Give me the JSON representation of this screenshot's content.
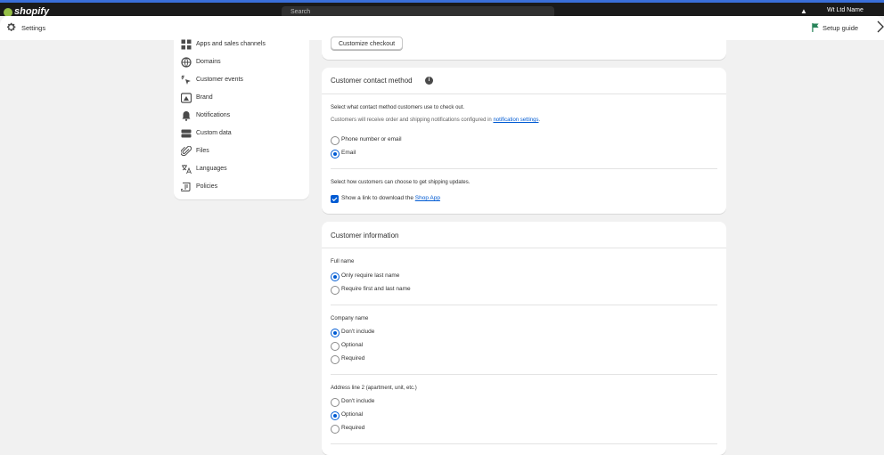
{
  "topbar": {
    "logo": "shopify",
    "search_placeholder": "Search",
    "store_name": "Wt Ltd Name"
  },
  "header": {
    "title": "Settings",
    "setup_guide": "Setup guide"
  },
  "sidebar": {
    "items": [
      {
        "label": "Apps and sales channels",
        "icon": "apps-icon"
      },
      {
        "label": "Domains",
        "icon": "globe-icon"
      },
      {
        "label": "Customer events",
        "icon": "cursor-sparkle-icon"
      },
      {
        "label": "Brand",
        "icon": "brand-icon"
      },
      {
        "label": "Notifications",
        "icon": "bell-icon"
      },
      {
        "label": "Custom data",
        "icon": "database-icon"
      },
      {
        "label": "Files",
        "icon": "paperclip-icon"
      },
      {
        "label": "Languages",
        "icon": "translate-icon"
      },
      {
        "label": "Policies",
        "icon": "policy-icon"
      }
    ]
  },
  "checkout_card": {
    "customize_button": "Customize checkout"
  },
  "contact_card": {
    "title": "Customer contact method",
    "select_text": "Select what contact method customers use to check out.",
    "notify_prefix": "Customers will receive order and shipping notifications configured in ",
    "notify_link": "notification settings",
    "notify_suffix": ".",
    "options": [
      {
        "label": "Phone number or email",
        "selected": false
      },
      {
        "label": "Email",
        "selected": true
      }
    ],
    "shipping_text": "Select how customers can choose to get shipping updates.",
    "shop_app_prefix": "Show a link to download the ",
    "shop_app_link": "Shop App",
    "shop_app_checked": true
  },
  "info_card": {
    "title": "Customer information",
    "full_name": {
      "label": "Full name",
      "options": [
        {
          "label": "Only require last name",
          "selected": true
        },
        {
          "label": "Require first and last name",
          "selected": false
        }
      ]
    },
    "company_name": {
      "label": "Company name",
      "options": [
        {
          "label": "Don't include",
          "selected": true
        },
        {
          "label": "Optional",
          "selected": false
        },
        {
          "label": "Required",
          "selected": false
        }
      ]
    },
    "address2": {
      "label": "Address line 2 (apartment, unit, etc.)",
      "options": [
        {
          "label": "Don't include",
          "selected": false
        },
        {
          "label": "Optional",
          "selected": true
        },
        {
          "label": "Required",
          "selected": false
        }
      ]
    }
  },
  "colors": {
    "accent": "#005bd3",
    "background": "#f1f1f1",
    "card": "#ffffff",
    "flag": "#29845a"
  }
}
